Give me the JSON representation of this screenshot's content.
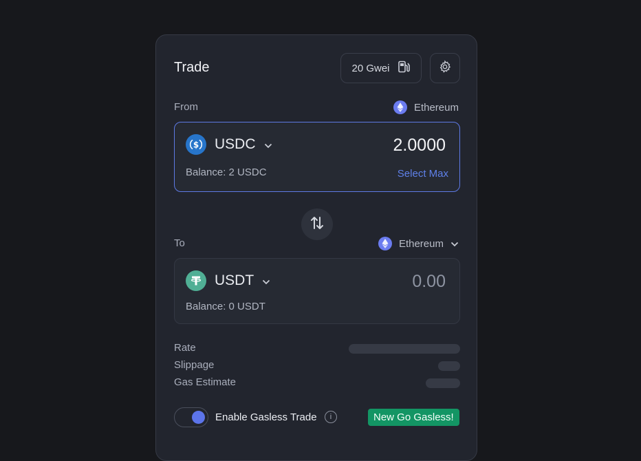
{
  "header": {
    "title": "Trade",
    "gas_label": "20 Gwei"
  },
  "from": {
    "label": "From",
    "chain": "Ethereum",
    "token": "USDC",
    "amount": "2.0000",
    "balance": "Balance: 2 USDC",
    "select_max": "Select Max"
  },
  "to": {
    "label": "To",
    "chain": "Ethereum",
    "token": "USDT",
    "amount": "0.00",
    "balance": "Balance: 0 USDT"
  },
  "details": {
    "rate_label": "Rate",
    "slippage_label": "Slippage",
    "gas_estimate_label": "Gas Estimate"
  },
  "gasless": {
    "label": "Enable Gasless Trade",
    "enabled": true,
    "info_glyph": "i",
    "badge": "New Go Gasless!"
  },
  "colors": {
    "accent": "#5f81ea",
    "usdc": "#2775ca",
    "usdt": "#50af95",
    "ethereum": "#6b7cf0",
    "badge": "#139564"
  },
  "icons": [
    "gas-pump-icon",
    "gear-icon",
    "ethereum-icon",
    "usdc-icon",
    "usdt-icon",
    "chevron-down-icon",
    "swap-arrows-icon",
    "info-icon"
  ]
}
